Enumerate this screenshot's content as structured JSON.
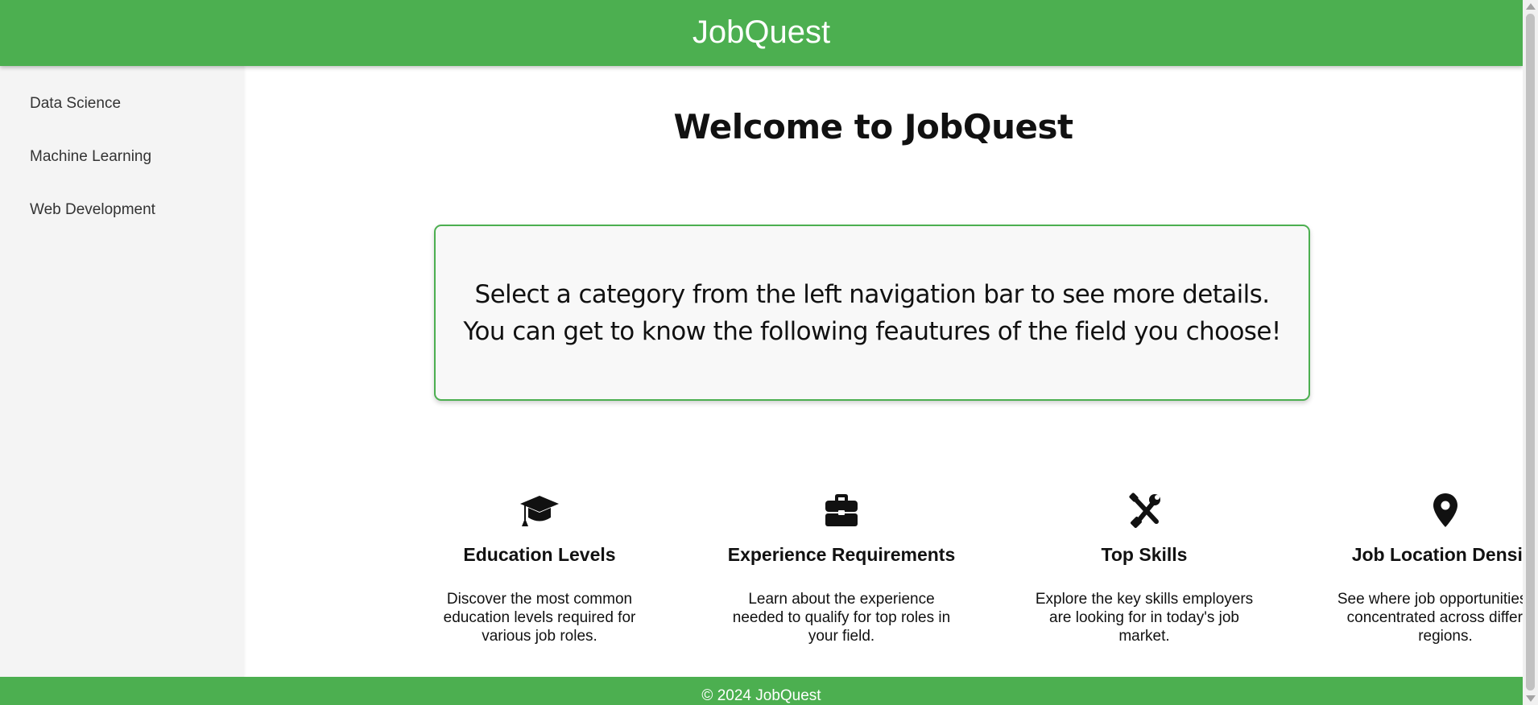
{
  "header": {
    "title": "JobQuest",
    "color": "#4caf50"
  },
  "sidebar": {
    "items": [
      {
        "label": "Data Science"
      },
      {
        "label": "Machine Learning"
      },
      {
        "label": "Web Development"
      }
    ]
  },
  "main": {
    "heading": "Welcome to JobQuest",
    "info": {
      "line1": "Select a category from the left navigation bar to see more details.",
      "line2": "You can get to know the following feautures of the field you choose!"
    },
    "features": [
      {
        "icon": "graduation-cap-icon",
        "title": "Education Levels",
        "description": "Discover the most common education levels required for various job roles."
      },
      {
        "icon": "briefcase-icon",
        "title": "Experience Requirements",
        "description": "Learn about the experience needed to qualify for top roles in your field."
      },
      {
        "icon": "tools-icon",
        "title": "Top Skills",
        "description": "Explore the key skills employers are looking for in today's job market."
      },
      {
        "icon": "map-pin-icon",
        "title": "Job Location Density",
        "description": "See where job opportunities are concentrated across different regions."
      }
    ]
  },
  "footer": {
    "text": "© 2024 JobQuest"
  }
}
